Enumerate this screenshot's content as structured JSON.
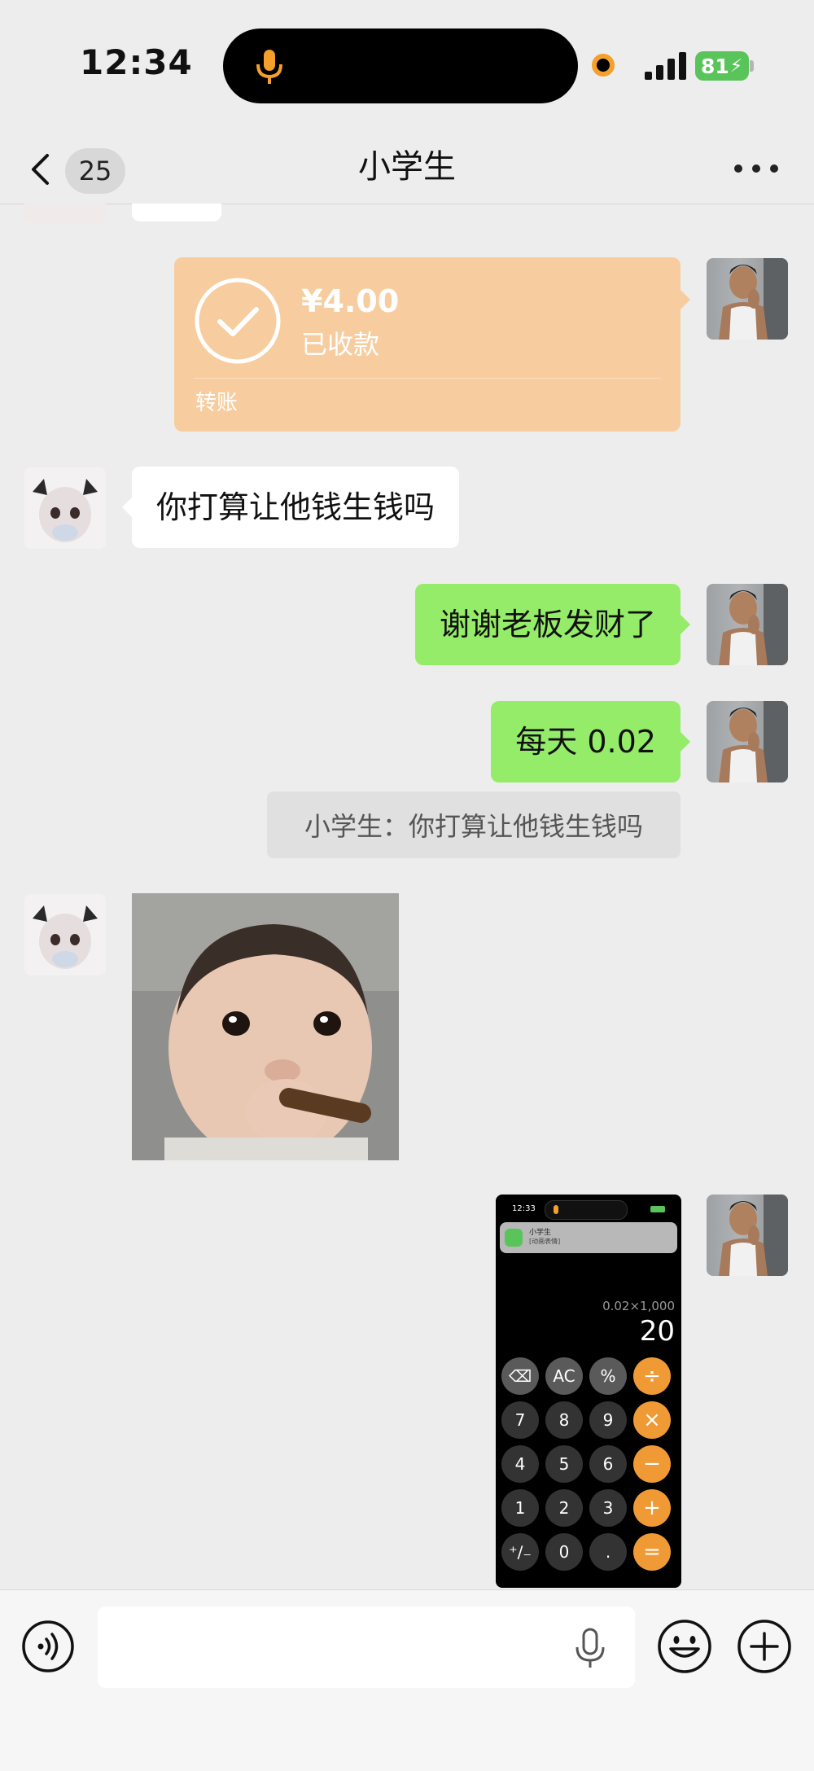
{
  "status_bar": {
    "time": "12:34",
    "battery": "81",
    "colors": {
      "orange_dot": "#f4a02a",
      "battery": "#58c45a"
    }
  },
  "nav": {
    "unread_count": "25",
    "title": "小学生"
  },
  "transfer": {
    "amount": "¥4.00",
    "status": "已收款",
    "label": "转账",
    "color": "#f7cda0"
  },
  "messages": {
    "m1": "你打算让他钱生钱吗",
    "m2": "谢谢老板发财了",
    "m3": "每天 0.02",
    "quote": "小学生：你打算让他钱生钱吗"
  },
  "sticker": {
    "icon": "baby-cigar-sticker"
  },
  "calc_screenshot": {
    "time": "12:33",
    "notification_title": "小学生",
    "notification_body": "[动画表情]",
    "expression": "0.02×1,000",
    "result": "20",
    "keys": [
      [
        "⌫",
        "AC",
        "%",
        "÷"
      ],
      [
        "7",
        "8",
        "9",
        "×"
      ],
      [
        "4",
        "5",
        "6",
        "−"
      ],
      [
        "1",
        "2",
        "3",
        "+"
      ],
      [
        "⁺∕₋",
        "0",
        ".",
        "="
      ]
    ]
  },
  "input": {
    "placeholder": "",
    "value": ""
  },
  "colors": {
    "bubble_green": "#95ec69",
    "background": "#ededed"
  }
}
